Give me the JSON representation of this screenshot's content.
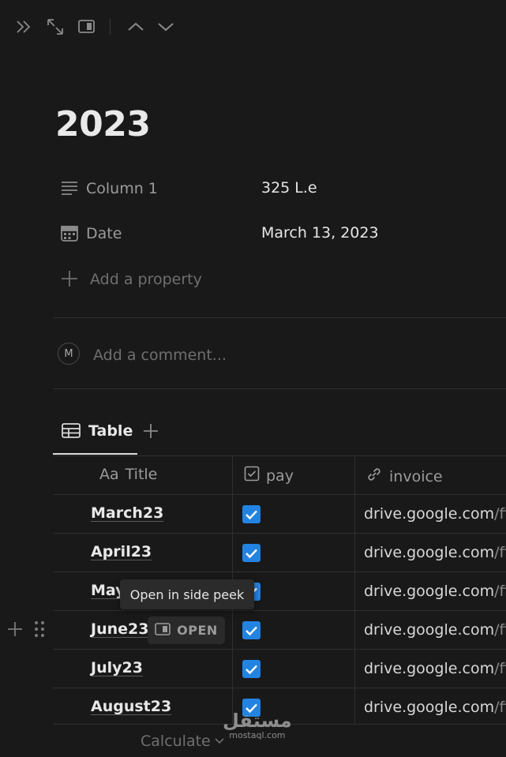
{
  "toolbar": {
    "icons": [
      "double-chevron-right-icon",
      "expand-icon",
      "side-peek-icon",
      "chevron-up-icon",
      "chevron-down-icon"
    ]
  },
  "page": {
    "title": "2023"
  },
  "properties": [
    {
      "icon": "text-lines-icon",
      "label": "Column 1",
      "value": "325 L.e"
    },
    {
      "icon": "calendar-icon",
      "label": "Date",
      "value": "March 13, 2023"
    }
  ],
  "add_property_label": "Add a property",
  "comment": {
    "avatar_initial": "M",
    "placeholder": "Add a comment..."
  },
  "view_tab": {
    "label": "Table",
    "icon": "table-icon"
  },
  "table": {
    "columns": [
      {
        "prefix": "Aa",
        "label": "Title"
      },
      {
        "icon": "checkbox-icon",
        "label": "pay"
      },
      {
        "icon": "link-icon",
        "label": "invoice"
      }
    ],
    "rows": [
      {
        "title": "March23",
        "pay": true,
        "invoice": "drive.google.com",
        "invoice_rest": "/fi"
      },
      {
        "title": "April23",
        "pay": true,
        "invoice": "drive.google.com",
        "invoice_rest": "/fi"
      },
      {
        "title": "May",
        "pay": true,
        "invoice": "drive.google.com",
        "invoice_rest": "/fi"
      },
      {
        "title": "June23",
        "pay": true,
        "invoice": "drive.google.com",
        "invoice_rest": "/fi"
      },
      {
        "title": "July23",
        "pay": true,
        "invoice": "drive.google.com",
        "invoice_rest": "/fi"
      },
      {
        "title": "August23",
        "pay": true,
        "invoice": "drive.google.com",
        "invoice_rest": "/fi"
      }
    ]
  },
  "tooltip": {
    "text": "Open in side peek"
  },
  "open_button": {
    "label": "OPEN"
  },
  "footer": {
    "calculate_label": "Calculate"
  },
  "watermark": {
    "arabic": "مستقل",
    "latin": "mostaql.com"
  },
  "colors": {
    "background": "#191919",
    "checkbox": "#2383e2",
    "text": "#e8e8e8",
    "muted": "#8a8a8a"
  }
}
